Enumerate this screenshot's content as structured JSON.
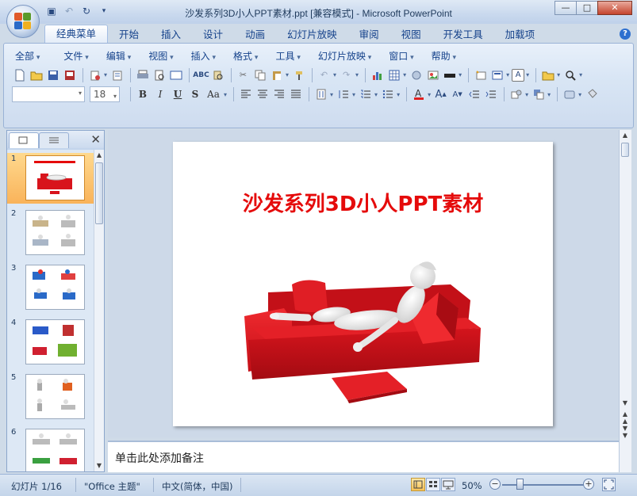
{
  "window": {
    "title": "沙发系列3D小人PPT素材.ppt [兼容模式] - Microsoft PowerPoint",
    "buttons": {
      "minimize": "—",
      "maximize": "□",
      "close": "✕"
    }
  },
  "ribbon": {
    "tabs": [
      "经典菜单",
      "开始",
      "插入",
      "设计",
      "动画",
      "幻灯片放映",
      "审阅",
      "视图",
      "开发工具",
      "加载项"
    ],
    "active_tab": "经典菜单",
    "menus": [
      "全部",
      "文件",
      "编辑",
      "视图",
      "插入",
      "格式",
      "工具",
      "幻灯片放映",
      "窗口",
      "帮助"
    ],
    "font_size": "18",
    "format_buttons": {
      "bold": "B",
      "italic": "I",
      "underline": "U",
      "shadow": "S",
      "case": "Aa"
    }
  },
  "slides": {
    "numbers": [
      "1",
      "2",
      "3",
      "4",
      "5",
      "6"
    ],
    "selected": "1"
  },
  "slide": {
    "title": "沙发系列3D小人PPT素材",
    "title_color": "#e50b0b"
  },
  "notes": {
    "placeholder": "单击此处添加备注"
  },
  "status": {
    "slide_info": "幻灯片 1/16",
    "theme": "\"Office 主题\"",
    "language": "中文(简体，中国)",
    "zoom": "50%"
  }
}
